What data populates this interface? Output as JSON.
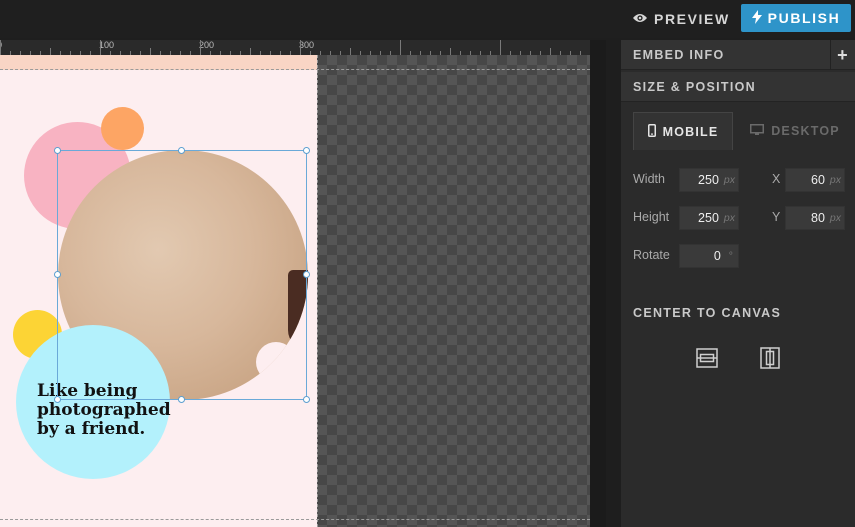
{
  "topbar": {
    "preview_label": "PREVIEW",
    "publish_label": "PUBLISH"
  },
  "ruler": {
    "labels": [
      "0",
      "100",
      "200",
      "300"
    ]
  },
  "canvas": {
    "caption": "Like being photographed by a friend."
  },
  "panel": {
    "embed_info": "EMBED INFO",
    "size_position": "SIZE & POSITION",
    "tabs": {
      "mobile": "MOBILE",
      "desktop": "DESKTOP"
    },
    "width_label": "Width",
    "height_label": "Height",
    "rotate_label": "Rotate",
    "x_label": "X",
    "y_label": "Y",
    "width_value": "250",
    "height_value": "250",
    "rotate_value": "0",
    "x_value": "60",
    "y_value": "80",
    "px_unit": "px",
    "deg_unit": "°",
    "center_to_canvas": "CENTER TO CANVAS"
  },
  "colors": {
    "publish": "#2e94c9",
    "artboard_bg": "#fdeef0",
    "pink_circle": "#f8b3c2",
    "orange_circle": "#fda564",
    "yellow_circle": "#fcd435",
    "cyan_circle": "#b3f1fc",
    "selection": "#6aa9d8"
  },
  "icons": {
    "preview": "eye-icon",
    "publish": "lightning-icon",
    "mobile": "phone-icon",
    "desktop": "monitor-icon",
    "add": "plus-icon",
    "center_horizontal": "center-horizontal-icon",
    "center_vertical": "center-vertical-icon"
  }
}
